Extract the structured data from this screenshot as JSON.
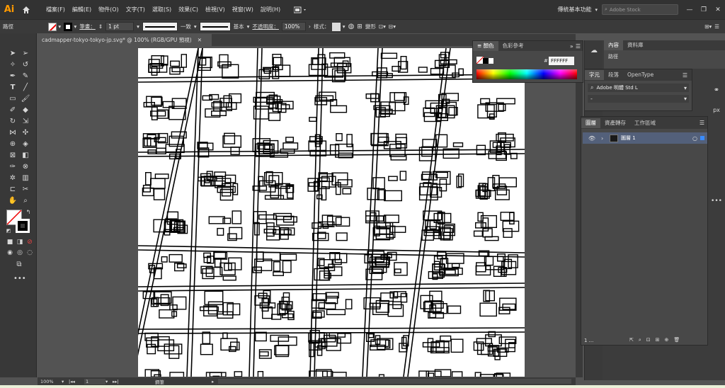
{
  "app": {
    "logo": "Ai"
  },
  "menu": [
    "檔案(F)",
    "編輯(E)",
    "物件(O)",
    "文字(T)",
    "選取(S)",
    "效果(C)",
    "檢視(V)",
    "視窗(W)",
    "說明(H)"
  ],
  "workspace": {
    "name": "傳統基本功能",
    "search_placeholder": "Adobe Stock"
  },
  "control": {
    "selection_label": "路徑",
    "stroke_label": "筆畫：",
    "stroke_value": "1 pt",
    "profile_label": "一致",
    "brush_label": "基本",
    "opacity_label": "不透明度：",
    "opacity_value": "100%",
    "style_label": "樣式：",
    "transform_label": "變形"
  },
  "document": {
    "tab_title": "cadmapper-tokyo-tokyo-jp.svg* @ 100% (RGB/GPU 預視)"
  },
  "status": {
    "zoom": "100%",
    "artboard": "1",
    "tool_hint": "鋼筆"
  },
  "color_panel": {
    "tabs": [
      "顏色",
      "色彩參考"
    ],
    "hex_prefix": "#",
    "hex": "FFFFFF"
  },
  "properties_panel": {
    "tabs": [
      "內容",
      "資料庫"
    ],
    "selection": "路徑"
  },
  "character_panel": {
    "tabs": [
      "字元",
      "段落",
      "OpenType"
    ],
    "font": "Adobe 明體 Std L",
    "unit": "px",
    "style": "-"
  },
  "layers_panel": {
    "tabs": [
      "圖層",
      "資產轉存",
      "工作區域"
    ],
    "layer_name": "圖層 1",
    "count": "1 ..."
  },
  "colors": {
    "accent": "#ff9a00",
    "panel": "#484848",
    "selection": "#53607a"
  }
}
